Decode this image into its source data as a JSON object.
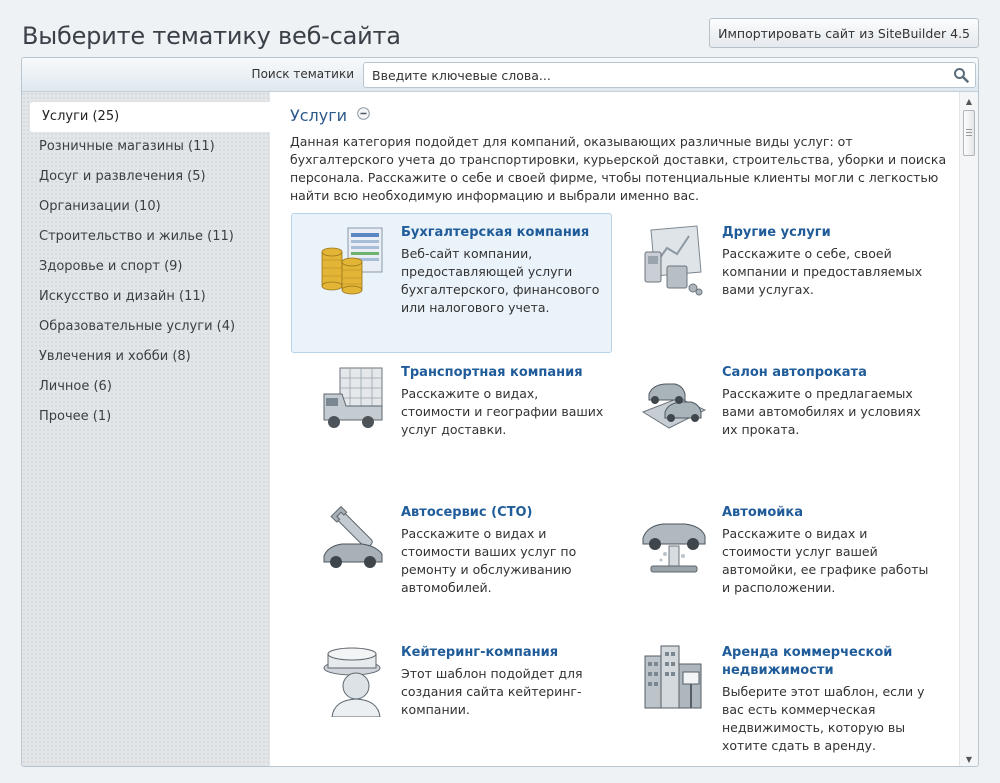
{
  "page": {
    "title": "Выберите тематику веб-сайта",
    "import_button": "Импортировать сайт из SiteBuilder 4.5"
  },
  "search": {
    "label": "Поиск тематики",
    "placeholder": "Введите ключевые слова..."
  },
  "sidebar": {
    "items": [
      {
        "label": "Услуги (25)",
        "active": true
      },
      {
        "label": "Розничные магазины (11)"
      },
      {
        "label": "Досуг и развлечения (5)"
      },
      {
        "label": "Организации (10)"
      },
      {
        "label": "Строительство и жилье (11)"
      },
      {
        "label": "Здоровье и спорт (9)"
      },
      {
        "label": "Искусство и дизайн (11)"
      },
      {
        "label": "Образовательные услуги (4)"
      },
      {
        "label": "Увлечения и хобби (8)"
      },
      {
        "label": "Личное (6)"
      },
      {
        "label": "Прочее (1)"
      }
    ]
  },
  "category": {
    "title": "Услуги",
    "description": "Данная категория подойдет для компаний, оказывающих различные виды услуг: от бухгалтерского учета до транспортировки, курьерской доставки, строительства, уборки и поиска персонала. Расскажите о себе и своей фирме, чтобы потенциальные клиенты могли с легкостью найти всю необходимую информацию и выбрали именно вас."
  },
  "templates": [
    {
      "title": "Бухгалтерская компания",
      "description": "Веб-сайт компании, предоставляющей услуги бухгалтерского, финансового или налогового учета.",
      "icon": "coins-icon",
      "selected": true
    },
    {
      "title": "Другие услуги",
      "description": "Расскажите о себе, своей компании и предоставляемых вами услугах.",
      "icon": "office-tools-icon"
    },
    {
      "title": "Транспортная компания",
      "description": "Расскажите о видах, стоимости и географии ваших услуг доставки.",
      "icon": "truck-icon"
    },
    {
      "title": "Салон автопроката",
      "description": "Расскажите о предлагаемых вами автомобилях и условиях их проката.",
      "icon": "rental-cars-icon"
    },
    {
      "title": "Автосервис (СТО)",
      "description": "Расскажите о видах и стоимости ваших услуг по ремонту и обслуживанию автомобилей.",
      "icon": "car-wrench-icon"
    },
    {
      "title": "Автомойка",
      "description": "Расскажите о видах и стоимости услуг вашей автомойки, ее графике работы и расположении.",
      "icon": "car-wash-icon"
    },
    {
      "title": "Кейтеринг-компания",
      "description": "Этот шаблон подойдет для создания сайта кейтеринг-компании.",
      "icon": "chef-icon"
    },
    {
      "title": "Аренда коммерческой недвижимости",
      "description": "Выберите этот шаблон, если у вас есть коммерческая недвижимость, которую вы хотите сдать в аренду.",
      "icon": "buildings-icon"
    }
  ]
}
